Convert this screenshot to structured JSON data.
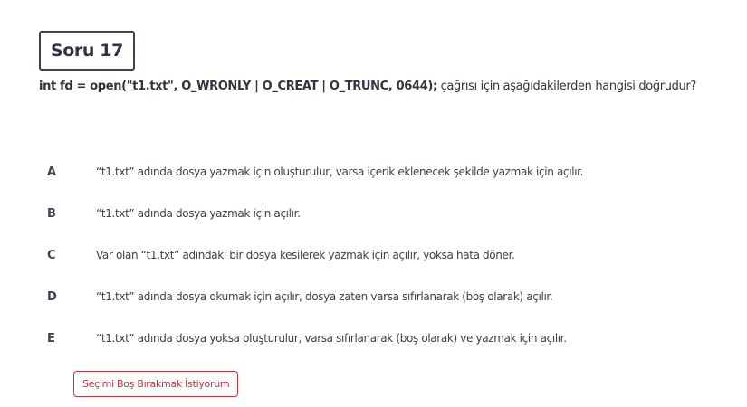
{
  "question": {
    "badge": "Soru 17",
    "code": "int fd = open(\"t1.txt\", O_WRONLY | O_CREAT | O_TRUNC, 0644);",
    "prompt": " çağrısı için aşağıdakilerden hangisi doğrudur?"
  },
  "options": [
    {
      "letter": "A",
      "text": "“t1.txt” adında dosya yazmak için oluşturulur, varsa içerik eklenecek şekilde yazmak için açılır."
    },
    {
      "letter": "B",
      "text": "“t1.txt” adında dosya yazmak için açılır."
    },
    {
      "letter": "C",
      "text": "Var olan “t1.txt” adındaki bir dosya kesilerek yazmak için açılır, yoksa hata döner."
    },
    {
      "letter": "D",
      "text": "“t1.txt” adında dosya okumak için açılır, dosya zaten varsa sıfırlanarak (boş olarak) açılır."
    },
    {
      "letter": "E",
      "text": "“t1.txt” adında dosya yoksa oluşturulur, varsa sıfırlanarak (boş olarak) ve yazmak için açılır."
    }
  ],
  "skip_button": {
    "label": "Seçimi Boş Bırakmak İstiyorum"
  },
  "colors": {
    "accent": "#c0343c",
    "text": "#3a3f4b",
    "border": "#3c4250"
  }
}
